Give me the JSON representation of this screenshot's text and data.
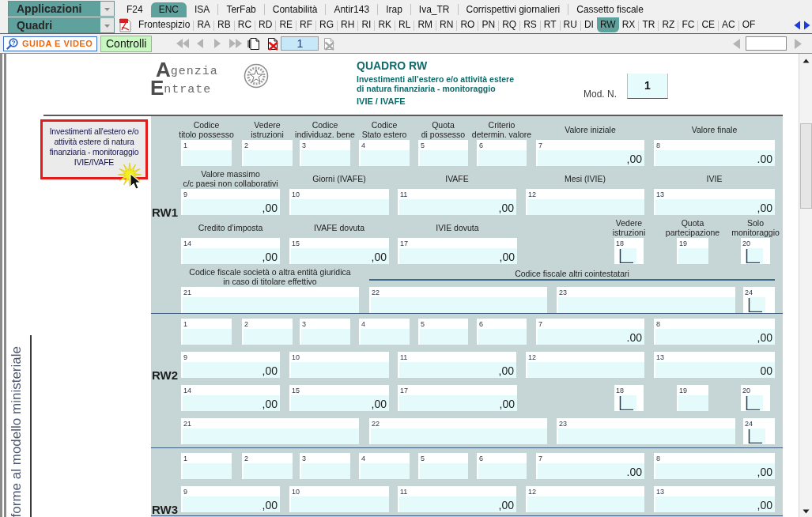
{
  "app_menu": {
    "label": "Applicazioni"
  },
  "app_tabs": [
    {
      "label": "F24",
      "selected": false
    },
    {
      "label": "ENC",
      "selected": true
    },
    {
      "label": "ISA",
      "selected": false
    },
    {
      "label": "TerFab",
      "selected": false
    },
    {
      "label": "Contabilità",
      "selected": false
    },
    {
      "label": "Antir143",
      "selected": false
    },
    {
      "label": "Irap",
      "selected": false
    },
    {
      "label": "Iva_TR",
      "selected": false
    },
    {
      "label": "Corrispettivi giornalieri",
      "selected": false
    },
    {
      "label": "Cassetto fiscale",
      "selected": false
    }
  ],
  "section_menu": {
    "label": "Quadri"
  },
  "section_tabs": [
    {
      "label": "Frontespizio",
      "selected": false
    },
    {
      "label": "RA",
      "selected": false
    },
    {
      "label": "RB",
      "selected": false
    },
    {
      "label": "RC",
      "selected": false
    },
    {
      "label": "RD",
      "selected": false
    },
    {
      "label": "RE",
      "selected": false
    },
    {
      "label": "RF",
      "selected": false
    },
    {
      "label": "RG",
      "selected": false
    },
    {
      "label": "RH",
      "selected": false
    },
    {
      "label": "RI",
      "selected": false
    },
    {
      "label": "RK",
      "selected": false
    },
    {
      "label": "RL",
      "selected": false
    },
    {
      "label": "RM",
      "selected": false
    },
    {
      "label": "RN",
      "selected": false
    },
    {
      "label": "RO",
      "selected": false
    },
    {
      "label": "PN",
      "selected": false
    },
    {
      "label": "RQ",
      "selected": false
    },
    {
      "label": "RS",
      "selected": false
    },
    {
      "label": "RT",
      "selected": false
    },
    {
      "label": "RU",
      "selected": false
    },
    {
      "label": "DI",
      "selected": false
    },
    {
      "label": "RW",
      "selected": true
    },
    {
      "label": "RX",
      "selected": false
    },
    {
      "label": "TR",
      "selected": false
    },
    {
      "label": "RZ",
      "selected": false
    },
    {
      "label": "FC",
      "selected": false
    },
    {
      "label": "CE",
      "selected": false
    },
    {
      "label": "AC",
      "selected": false
    },
    {
      "label": "OF",
      "selected": false
    }
  ],
  "toolbar": {
    "guide_button": "GUIDA E VIDEO",
    "checks_button": "Controlli",
    "navigation": [
      {
        "disabled": true
      },
      {
        "disabled": true
      },
      {
        "disabled": true
      },
      {
        "disabled": true
      }
    ],
    "page_buttons": [
      {
        "disabled": false
      },
      {
        "disabled": false
      },
      {
        "disabled": true
      }
    ],
    "page_field": "1",
    "jump": {
      "disabled": true
    }
  },
  "document": {
    "logo": {
      "line_1": "Agenzia",
      "line_2": "Entrate"
    },
    "title": "QUADRO RW",
    "subtitle": "Investimenti all’estero e/o attività estere\ndi natura finanziaria - monitoraggio",
    "tax_line": "IVIE / IVAFE",
    "module_label": "Mod. N.",
    "module_number": "1",
    "side_note": "Investimenti all'estero e/o\nattività estere di natura\nfinanziaria - monitoraggio\nIVIE/IVAFE",
    "vertical_caption": "forme al modello ministeriale",
    "sections": [
      {
        "code": "RW1",
        "rows": [
          {
            "fields": [
              {
                "kind": "input",
                "number": "1",
                "label": "Codice\ntitolo possesso"
              },
              {
                "kind": "input",
                "number": "2",
                "label": "Vedere\nistruzioni"
              },
              {
                "kind": "input",
                "number": "3",
                "label": "Codice\nindividuaz. bene"
              },
              {
                "kind": "input",
                "number": "4",
                "label": "Codice\nStato estero"
              },
              {
                "kind": "input",
                "number": "5",
                "label": "Quota\ndi possesso"
              },
              {
                "kind": "input",
                "number": "6",
                "label": "Criterio\ndetermin. valore"
              },
              {
                "kind": "input",
                "number": "7",
                "label": "Valore iniziale",
                "suffix": ",00"
              },
              {
                "kind": "input",
                "number": "8",
                "label": "Valore finale",
                "suffix": ".00"
              }
            ]
          },
          {
            "fields": [
              {
                "kind": "input",
                "number": "9",
                "label": "Valore massimo\nc/c paesi non collaborativi",
                "suffix": ",00"
              },
              {
                "kind": "input",
                "number": "10",
                "label": "Giorni (IVAFE)"
              },
              {
                "kind": "input",
                "number": "11",
                "label": "IVAFE",
                "suffix": ",00"
              },
              {
                "kind": "input",
                "number": "12",
                "label": "Mesi (IVIE)"
              },
              {
                "kind": "input",
                "number": "13",
                "label": "IVIE",
                "suffix": ",00"
              }
            ]
          },
          {
            "fields": [
              {
                "kind": "input",
                "number": "14",
                "label": "Credito d’imposta",
                "suffix": ",00"
              },
              {
                "kind": "input",
                "number": "15",
                "label": "IVAFE dovuta",
                "suffix": ",00"
              },
              {
                "kind": "input",
                "number": "17",
                "label": "IVIE dovuta",
                "suffix": ",00"
              },
              {
                "kind": "check",
                "number": "18",
                "label": "Vedere\nistruzioni"
              },
              {
                "kind": "input",
                "number": "19",
                "label": "Quota\npartecipazione"
              },
              {
                "kind": "check",
                "number": "20",
                "label": "Solo\nmonitoraggio"
              }
            ]
          },
          {
            "heading": "Codice fiscale altri cointestatari",
            "fields": [
              {
                "kind": "input",
                "number": "21",
                "label": "Codice fiscale società o altra entità giuridica\nin caso di titolare effettivo"
              },
              {
                "kind": "input",
                "number": "22"
              },
              {
                "kind": "input",
                "number": "23"
              },
              {
                "kind": "check",
                "number": "24"
              }
            ]
          }
        ]
      },
      {
        "code": "RW2",
        "rows": [
          {
            "fields": [
              {
                "kind": "input",
                "number": "1"
              },
              {
                "kind": "input",
                "number": "2"
              },
              {
                "kind": "input",
                "number": "3"
              },
              {
                "kind": "input",
                "number": "4"
              },
              {
                "kind": "input",
                "number": "5"
              },
              {
                "kind": "input",
                "number": "6"
              },
              {
                "kind": "input",
                "number": "7",
                "suffix": ".00"
              },
              {
                "kind": "input",
                "number": "8",
                "suffix": ",00"
              }
            ]
          },
          {
            "fields": [
              {
                "kind": "input",
                "number": "9",
                "suffix": ",00"
              },
              {
                "kind": "input",
                "number": "10"
              },
              {
                "kind": "input",
                "number": "11",
                "suffix": ",00"
              },
              {
                "kind": "input",
                "number": "12"
              },
              {
                "kind": "input",
                "number": "13",
                "suffix": "00"
              }
            ]
          },
          {
            "fields": [
              {
                "kind": "input",
                "number": "14",
                "suffix": ",00"
              },
              {
                "kind": "input",
                "number": "15",
                "suffix": ",00"
              },
              {
                "kind": "input",
                "number": "17",
                "suffix": ",00"
              },
              {
                "kind": "check",
                "number": "18"
              },
              {
                "kind": "input",
                "number": "19"
              },
              {
                "kind": "check",
                "number": "20"
              }
            ]
          },
          {
            "fields": [
              {
                "kind": "input",
                "number": "21"
              },
              {
                "kind": "input",
                "number": "22"
              },
              {
                "kind": "input",
                "number": "23"
              },
              {
                "kind": "check",
                "number": "24"
              }
            ]
          }
        ]
      },
      {
        "code": "RW3",
        "rows": [
          {
            "fields": [
              {
                "kind": "input",
                "number": "1"
              },
              {
                "kind": "input",
                "number": "2"
              },
              {
                "kind": "input",
                "number": "3"
              },
              {
                "kind": "input",
                "number": "4"
              },
              {
                "kind": "input",
                "number": "5"
              },
              {
                "kind": "input",
                "number": "6"
              },
              {
                "kind": "input",
                "number": "7",
                "suffix": ".00"
              },
              {
                "kind": "input",
                "number": "8",
                "suffix": ",00"
              }
            ]
          },
          {
            "fields": [
              {
                "kind": "input",
                "number": "9",
                "suffix": ",00"
              },
              {
                "kind": "input",
                "number": "10"
              },
              {
                "kind": "input",
                "number": "11",
                "suffix": ",00"
              },
              {
                "kind": "input",
                "number": "12"
              },
              {
                "kind": "input",
                "number": "13",
                "suffix": ",00"
              }
            ]
          }
        ]
      }
    ]
  }
}
